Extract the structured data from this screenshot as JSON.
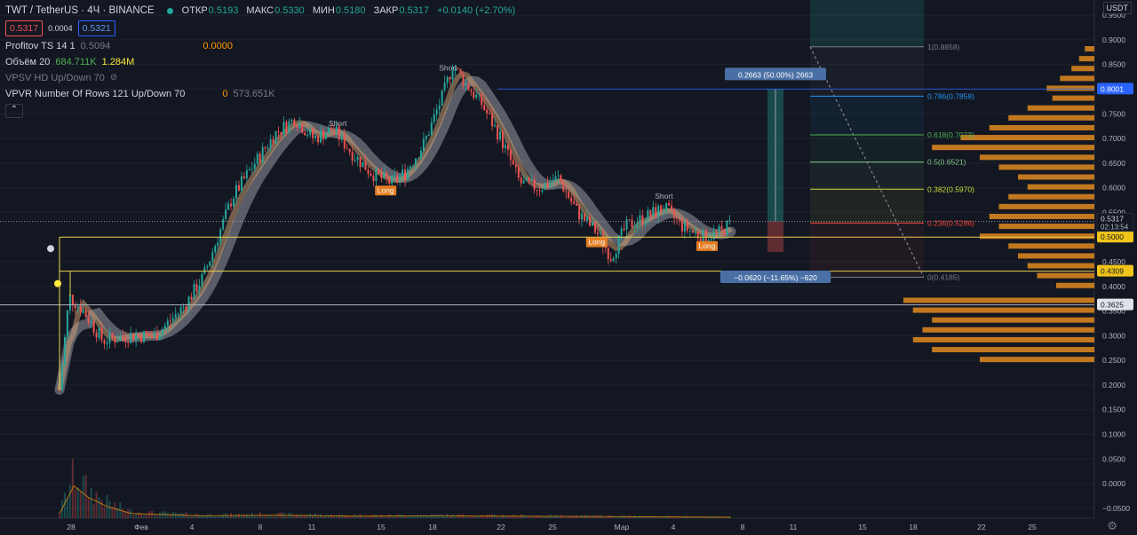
{
  "header": {
    "symbol": "TWT / TetherUS · 4Ч · BINANCE",
    "ohlc": [
      {
        "k": "ОТКР",
        "v": "0.5193"
      },
      {
        "k": "МАКС",
        "v": "0.5330"
      },
      {
        "k": "МИН",
        "v": "0.5180"
      },
      {
        "k": "ЗАКР",
        "v": "0.5317"
      }
    ],
    "change": "+0.0140 (+2.70%)",
    "sell_price": "0.5317",
    "spread": "0.0004",
    "buy_price": "0.5321",
    "colors": {
      "up": "#26a69a",
      "down": "#ef5350"
    }
  },
  "indicators": [
    {
      "name": "Profitov TS 14 1",
      "v1": "0.5094",
      "v2": "0.0000"
    },
    {
      "name": "Объём 20",
      "v1": "684.711K",
      "v2": "1.284M"
    },
    {
      "name": "VPSV HD Up/Down 70"
    },
    {
      "name": "VPVR Number Of Rows 121 Up/Down 70",
      "v1": "0",
      "v2": "573.651K"
    }
  ],
  "currency": "USDT",
  "chart_data": {
    "type": "candlestick",
    "price_axis": {
      "min": -0.07,
      "max": 0.97,
      "ticks": [
        0.95,
        0.9,
        0.85,
        0.8,
        0.75,
        0.7,
        0.65,
        0.6,
        0.55,
        0.45,
        0.4,
        0.35,
        0.3,
        0.25,
        0.2,
        0.15,
        0.1,
        0.05,
        0.0,
        -0.05
      ],
      "tick_labels": [
        "0.9500",
        "0.9000",
        "0.8500",
        "0.8000",
        "0.7500",
        "0.7000",
        "0.6500",
        "0.6000",
        "0.5500",
        "0.4500",
        "0.4000",
        "0.3500",
        "0.3000",
        "0.2500",
        "0.2000",
        "0.1500",
        "0.1000",
        "0.0500",
        "0.0000",
        "−0.0500"
      ]
    },
    "time_axis": [
      "28",
      "Фев",
      "4",
      "8",
      "11",
      "15",
      "18",
      "22",
      "25",
      "Мар",
      "4",
      "8",
      "11",
      "15",
      "18",
      "22",
      "25"
    ],
    "price_path": [
      [
        0,
        0.19
      ],
      [
        2,
        0.38
      ],
      [
        5,
        0.35
      ],
      [
        9,
        0.29
      ],
      [
        14,
        0.3
      ],
      [
        20,
        0.3
      ],
      [
        26,
        0.36
      ],
      [
        30,
        0.42
      ],
      [
        33,
        0.5
      ],
      [
        36,
        0.58
      ],
      [
        40,
        0.64
      ],
      [
        45,
        0.71
      ],
      [
        49,
        0.74
      ],
      [
        53,
        0.7
      ],
      [
        57,
        0.72
      ],
      [
        61,
        0.67
      ],
      [
        65,
        0.63
      ],
      [
        69,
        0.61
      ],
      [
        72,
        0.63
      ],
      [
        76,
        0.69
      ],
      [
        80,
        0.79
      ],
      [
        82,
        0.85
      ],
      [
        84,
        0.82
      ],
      [
        88,
        0.77
      ],
      [
        92,
        0.7
      ],
      [
        96,
        0.61
      ],
      [
        100,
        0.6
      ],
      [
        104,
        0.62
      ],
      [
        108,
        0.55
      ],
      [
        112,
        0.51
      ],
      [
        115,
        0.46
      ],
      [
        118,
        0.52
      ],
      [
        122,
        0.54
      ],
      [
        126,
        0.56
      ],
      [
        130,
        0.52
      ],
      [
        134,
        0.5
      ],
      [
        138,
        0.51
      ],
      [
        140,
        0.53
      ]
    ],
    "volume_path": [
      [
        0,
        0.02
      ],
      [
        3,
        0.14
      ],
      [
        6,
        0.09
      ],
      [
        10,
        0.05
      ],
      [
        15,
        0.02
      ],
      [
        30,
        0.01
      ],
      [
        45,
        0.013
      ],
      [
        60,
        0.009
      ],
      [
        80,
        0.01
      ],
      [
        100,
        0.008
      ],
      [
        120,
        0.006
      ],
      [
        140,
        0.004
      ]
    ],
    "horizontal_levels": [
      {
        "price": "0.5000",
        "value": 0.5
      },
      {
        "price": "0.4309",
        "value": 0.4309
      },
      {
        "price": "0.3625",
        "value": 0.3625
      }
    ],
    "current_price": {
      "value": 0.5317,
      "label": "0.5317",
      "timer": "02:13:54"
    },
    "position": {
      "entry": 0.5317,
      "target": 0.8001,
      "stop": 0.4697,
      "target_label": "0.2663 (50.00%) 2663",
      "stop_label": "−0.0620 (−11.65%) −620",
      "target_price_label": "0.8001"
    },
    "fibonacci": [
      {
        "label": "1(0.8858)",
        "value": 0.8858,
        "color": "#787b86"
      },
      {
        "label": "0.786(0.7858)",
        "value": 0.7858,
        "color": "#2196f3"
      },
      {
        "label": "0.618(0.7073)",
        "value": 0.7073,
        "color": "#4caf50"
      },
      {
        "label": "0.5(0.6521)",
        "value": 0.6521,
        "color": "#81c784"
      },
      {
        "label": "0.382(0.5970)",
        "value": 0.597,
        "color": "#cddc39"
      },
      {
        "label": "0.236(0.5286)",
        "value": 0.5286,
        "color": "#f44336"
      },
      {
        "label": "0(0.4185)",
        "value": 0.4185,
        "color": "#787b86"
      }
    ],
    "signals": [
      {
        "text": "Short",
        "t": 58
      },
      {
        "text": "Long",
        "t": 68
      },
      {
        "text": "Short",
        "t": 81
      },
      {
        "text": "Long",
        "t": 112
      },
      {
        "text": "Short",
        "t": 126
      },
      {
        "text": "Long",
        "t": 135
      }
    ],
    "volume_profile": [
      [
        0.88,
        0.05
      ],
      [
        0.86,
        0.08
      ],
      [
        0.84,
        0.12
      ],
      [
        0.82,
        0.18
      ],
      [
        0.8,
        0.25
      ],
      [
        0.78,
        0.22
      ],
      [
        0.76,
        0.35
      ],
      [
        0.74,
        0.45
      ],
      [
        0.72,
        0.55
      ],
      [
        0.7,
        0.7
      ],
      [
        0.68,
        0.85
      ],
      [
        0.66,
        0.6
      ],
      [
        0.64,
        0.5
      ],
      [
        0.62,
        0.4
      ],
      [
        0.6,
        0.35
      ],
      [
        0.58,
        0.45
      ],
      [
        0.56,
        0.5
      ],
      [
        0.54,
        0.55
      ],
      [
        0.52,
        0.5
      ],
      [
        0.5,
        0.6
      ],
      [
        0.48,
        0.45
      ],
      [
        0.46,
        0.4
      ],
      [
        0.44,
        0.35
      ],
      [
        0.42,
        0.3
      ],
      [
        0.4,
        0.2
      ],
      [
        0.37,
        1.0
      ],
      [
        0.35,
        0.95
      ],
      [
        0.33,
        0.85
      ],
      [
        0.31,
        0.9
      ],
      [
        0.29,
        0.95
      ],
      [
        0.27,
        0.85
      ],
      [
        0.25,
        0.6
      ]
    ]
  }
}
